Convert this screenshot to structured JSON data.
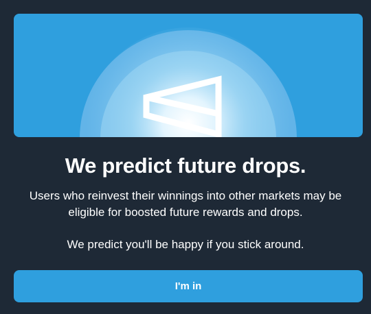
{
  "modal": {
    "title": "We predict future drops.",
    "paragraph_1": "Users who reinvest their winnings into other markets may be eligible for boosted future rewards and drops.",
    "paragraph_2": "We predict you'll be happy if you stick around.",
    "confirm_label": "I'm in"
  },
  "hero": {
    "icon": "polymarket-logo-icon"
  },
  "colors": {
    "background": "#1e2936",
    "accent": "#2f9fde",
    "text": "#ffffff"
  }
}
